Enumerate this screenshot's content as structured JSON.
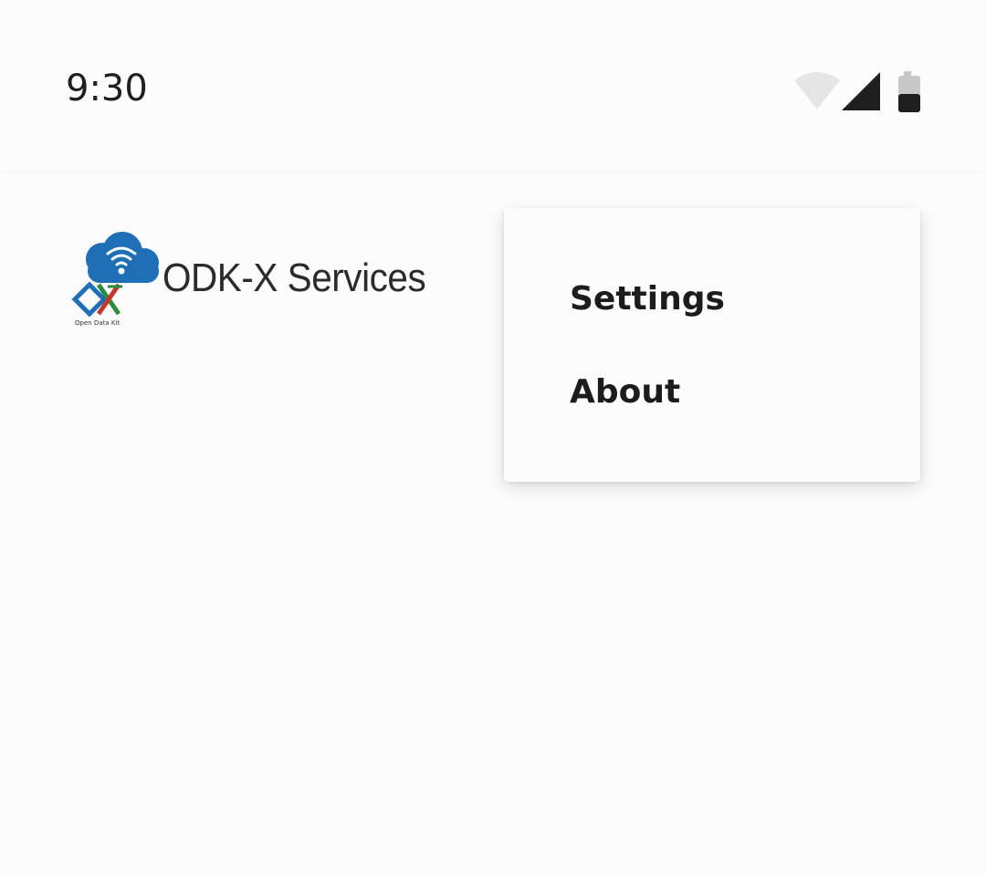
{
  "status_bar": {
    "time": "9:30",
    "icons": [
      "wifi-icon",
      "cell-signal-icon",
      "battery-icon"
    ]
  },
  "app_bar": {
    "title": "ODK-X Services",
    "logo_caption": "Open Data Kit"
  },
  "overflow_menu": {
    "items": [
      {
        "label": "Settings"
      },
      {
        "label": "About"
      }
    ]
  },
  "colors": {
    "background": "#fcfcfc",
    "text": "#1c1c1c",
    "logo_blue": "#1e6fb5",
    "logo_red": "#c0392b",
    "logo_green": "#2e8b3d"
  }
}
